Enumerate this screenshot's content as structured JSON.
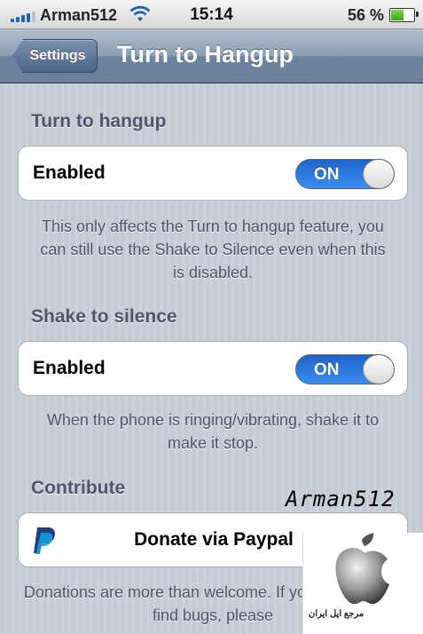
{
  "status_bar": {
    "carrier": "Arman512",
    "time": "15:14",
    "battery": "56 %",
    "battery_level": 0.56
  },
  "nav": {
    "back_label": "Settings",
    "title": "Turn to Hangup"
  },
  "sections": {
    "turn_to_hangup": {
      "header": "Turn to hangup",
      "cell_label": "Enabled",
      "toggle": "ON",
      "footnote": "This only affects the Turn to hangup feature, you can still use the Shake to Silence even when this is disabled."
    },
    "shake_to_silence": {
      "header": "Shake to silence",
      "cell_label": "Enabled",
      "toggle": "ON",
      "footnote": "When the phone is ringing/vibrating, shake it to make it stop."
    },
    "contribute": {
      "header": "Contribute",
      "donate_label": "Donate via Paypal",
      "footnote": "Donations are more than welcome. If you have tips or find bugs, please"
    }
  },
  "watermark": {
    "name": "Arman512",
    "caption": "مرجع اپل ایران"
  },
  "colors": {
    "toggle_on": "#2f7de5",
    "group_bg": "#c5ccd4",
    "section_text": "#4c566c"
  }
}
